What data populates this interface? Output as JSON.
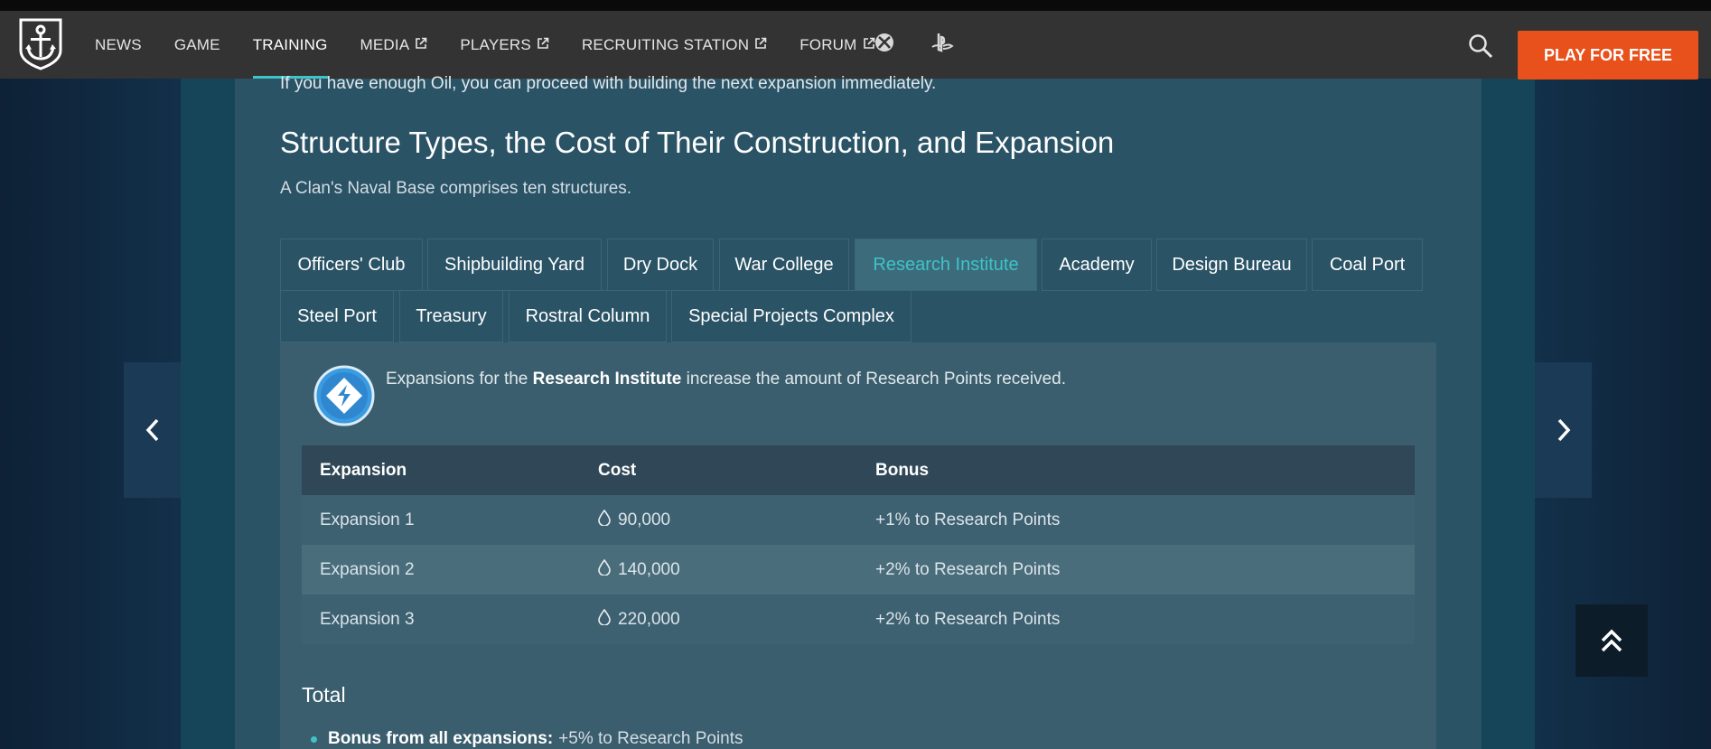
{
  "nav": {
    "links": [
      {
        "label": "NEWS",
        "external": false
      },
      {
        "label": "GAME",
        "external": false
      },
      {
        "label": "TRAINING",
        "external": false,
        "active": true
      },
      {
        "label": "MEDIA",
        "external": true
      },
      {
        "label": "PLAYERS",
        "external": true
      },
      {
        "label": "RECRUITING STATION",
        "external": true
      },
      {
        "label": "FORUM",
        "external": true
      }
    ],
    "platforms": [
      "xbox-icon",
      "playstation-icon"
    ],
    "cta": "PLAY FOR FREE"
  },
  "article": {
    "intro": "If you have enough Oil, you can proceed with building the next expansion immediately.",
    "heading": "Structure Types, the Cost of Their Construction, and Expansion",
    "subtext": "A Clan's Naval Base comprises ten structures."
  },
  "tabs": [
    "Officers' Club",
    "Shipbuilding Yard",
    "Dry Dock",
    "War College",
    "Research Institute",
    "Academy",
    "Design Bureau",
    "Coal Port",
    "Steel Port",
    "Treasury",
    "Rostral Column",
    "Special Projects Complex"
  ],
  "active_tab": "Research Institute",
  "panel": {
    "desc_prefix": "Expansions for the ",
    "desc_bold": "Research Institute",
    "desc_suffix": " increase the amount of Research Points received.",
    "table": {
      "headers": [
        "Expansion",
        "Cost",
        "Bonus"
      ],
      "rows": [
        {
          "expansion": "Expansion 1",
          "cost": "90,000",
          "bonus": "+1% to Research Points"
        },
        {
          "expansion": "Expansion 2",
          "cost": "140,000",
          "bonus": "+2% to Research Points"
        },
        {
          "expansion": "Expansion 3",
          "cost": "220,000",
          "bonus": "+2% to Research Points"
        }
      ]
    },
    "total_label": "Total",
    "total_bullet_bold": "Bonus from all expansions:",
    "total_bullet_text": "+5% to Research Points"
  },
  "colors": {
    "accent": "#3fc3c7",
    "cta": "#e8511b",
    "nav_bg": "#333333"
  }
}
